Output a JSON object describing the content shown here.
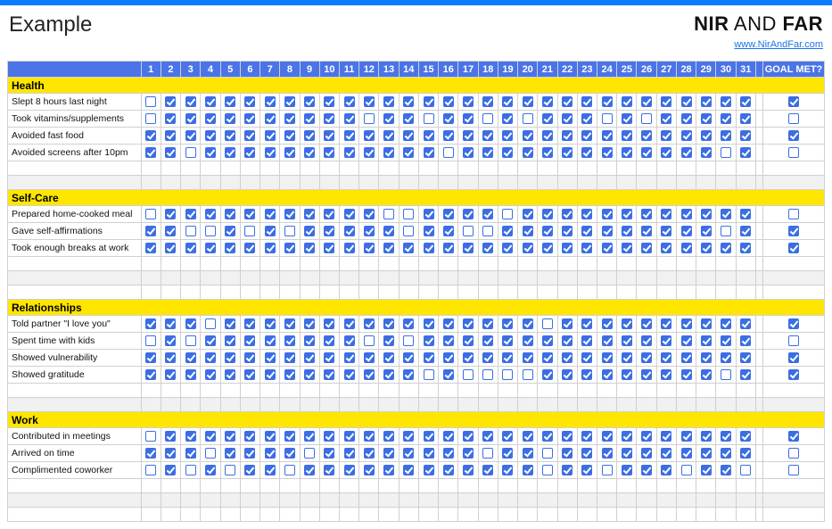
{
  "header": {
    "title": "Example",
    "brand_parts": {
      "nir": "NIR",
      "and": " AND ",
      "far": "FAR"
    },
    "brand_link": "www.NirAndFar.com"
  },
  "columns": {
    "days": [
      "1",
      "2",
      "3",
      "4",
      "5",
      "6",
      "7",
      "8",
      "9",
      "10",
      "11",
      "12",
      "13",
      "14",
      "15",
      "16",
      "17",
      "18",
      "19",
      "20",
      "21",
      "22",
      "23",
      "24",
      "25",
      "26",
      "27",
      "28",
      "29",
      "30",
      "31"
    ],
    "goal_label": "GOAL MET?"
  },
  "sections": [
    {
      "name": "Health",
      "rows": [
        {
          "label": "Slept 8 hours last night",
          "days": [
            false,
            true,
            true,
            true,
            true,
            true,
            true,
            true,
            true,
            true,
            true,
            true,
            true,
            true,
            true,
            true,
            true,
            true,
            true,
            true,
            true,
            true,
            true,
            true,
            true,
            true,
            true,
            true,
            true,
            true,
            true
          ],
          "goal": true
        },
        {
          "label": "Took vitamins/supplements",
          "days": [
            false,
            true,
            true,
            true,
            true,
            true,
            true,
            true,
            true,
            true,
            true,
            false,
            true,
            true,
            false,
            true,
            true,
            false,
            true,
            false,
            true,
            true,
            true,
            false,
            true,
            false,
            true,
            true,
            true,
            true,
            true
          ],
          "goal": false
        },
        {
          "label": "Avoided fast food",
          "days": [
            true,
            true,
            true,
            true,
            true,
            true,
            true,
            true,
            true,
            true,
            true,
            true,
            true,
            true,
            true,
            true,
            true,
            true,
            true,
            true,
            true,
            true,
            true,
            true,
            true,
            true,
            true,
            true,
            true,
            true,
            true
          ],
          "goal": true
        },
        {
          "label": "Avoided screens after 10pm",
          "days": [
            true,
            true,
            false,
            true,
            true,
            true,
            true,
            true,
            true,
            true,
            true,
            true,
            true,
            true,
            true,
            false,
            true,
            true,
            true,
            true,
            true,
            true,
            true,
            true,
            true,
            true,
            true,
            true,
            true,
            false,
            true
          ],
          "goal": false
        }
      ],
      "trailing_empty": 2
    },
    {
      "name": "Self-Care",
      "rows": [
        {
          "label": "Prepared home-cooked meal",
          "days": [
            false,
            true,
            true,
            true,
            true,
            true,
            true,
            true,
            true,
            true,
            true,
            true,
            false,
            false,
            true,
            true,
            true,
            true,
            false,
            true,
            true,
            true,
            true,
            true,
            true,
            true,
            true,
            true,
            true,
            true,
            true
          ],
          "goal": false
        },
        {
          "label": "Gave self-affirmations",
          "days": [
            true,
            true,
            false,
            false,
            true,
            false,
            true,
            false,
            true,
            true,
            true,
            true,
            true,
            false,
            true,
            true,
            false,
            false,
            true,
            true,
            true,
            true,
            true,
            true,
            true,
            true,
            true,
            true,
            true,
            false,
            true
          ],
          "goal": true
        },
        {
          "label": "Took enough breaks at work",
          "days": [
            true,
            true,
            true,
            true,
            true,
            true,
            true,
            true,
            true,
            true,
            true,
            true,
            true,
            true,
            true,
            true,
            true,
            true,
            true,
            true,
            true,
            true,
            true,
            true,
            true,
            true,
            true,
            true,
            true,
            true,
            true
          ],
          "goal": true
        }
      ],
      "trailing_empty": 3
    },
    {
      "name": "Relationships",
      "rows": [
        {
          "label": "Told partner \"I love you\"",
          "days": [
            true,
            true,
            true,
            false,
            true,
            true,
            true,
            true,
            true,
            true,
            true,
            true,
            true,
            true,
            true,
            true,
            true,
            true,
            true,
            true,
            false,
            true,
            true,
            true,
            true,
            true,
            true,
            true,
            true,
            true,
            true
          ],
          "goal": true
        },
        {
          "label": "Spent time with kids",
          "days": [
            false,
            true,
            false,
            true,
            true,
            true,
            true,
            true,
            true,
            true,
            true,
            false,
            true,
            false,
            true,
            true,
            true,
            true,
            true,
            true,
            true,
            true,
            true,
            true,
            true,
            true,
            true,
            true,
            true,
            true,
            true
          ],
          "goal": false
        },
        {
          "label": "Showed vulnerability",
          "days": [
            true,
            true,
            true,
            true,
            true,
            true,
            true,
            true,
            true,
            true,
            true,
            true,
            true,
            true,
            true,
            true,
            true,
            true,
            true,
            true,
            true,
            true,
            true,
            true,
            true,
            true,
            true,
            true,
            true,
            true,
            true
          ],
          "goal": true
        },
        {
          "label": "Showed gratitude",
          "days": [
            true,
            true,
            true,
            true,
            true,
            true,
            true,
            true,
            true,
            true,
            true,
            true,
            true,
            true,
            false,
            true,
            false,
            false,
            false,
            false,
            true,
            true,
            true,
            true,
            true,
            true,
            true,
            true,
            true,
            false,
            true
          ],
          "goal": true
        }
      ],
      "trailing_empty": 2
    },
    {
      "name": "Work",
      "rows": [
        {
          "label": "Contributed in meetings",
          "days": [
            false,
            true,
            true,
            true,
            true,
            true,
            true,
            true,
            true,
            true,
            true,
            true,
            true,
            true,
            true,
            true,
            true,
            true,
            true,
            true,
            true,
            true,
            true,
            true,
            true,
            true,
            true,
            true,
            true,
            true,
            true
          ],
          "goal": true
        },
        {
          "label": "Arrived on time",
          "days": [
            true,
            true,
            true,
            false,
            true,
            true,
            true,
            true,
            false,
            true,
            true,
            true,
            true,
            true,
            true,
            true,
            true,
            false,
            true,
            true,
            false,
            true,
            true,
            true,
            true,
            true,
            true,
            true,
            true,
            true,
            true
          ],
          "goal": false
        },
        {
          "label": "Complimented coworker",
          "days": [
            false,
            true,
            false,
            true,
            false,
            true,
            true,
            false,
            true,
            true,
            true,
            true,
            true,
            true,
            true,
            true,
            true,
            true,
            true,
            true,
            false,
            true,
            true,
            false,
            true,
            true,
            true,
            false,
            true,
            true,
            false
          ],
          "goal": false
        }
      ],
      "trailing_empty": 3
    }
  ]
}
